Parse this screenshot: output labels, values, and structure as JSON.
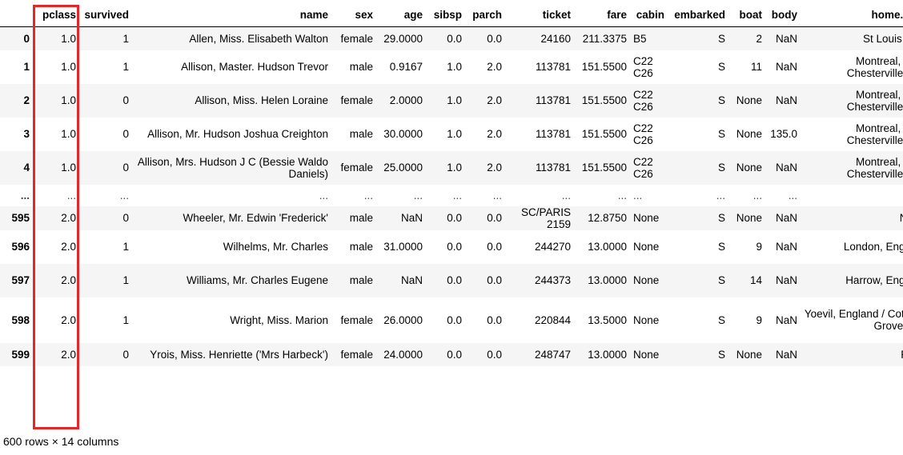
{
  "table": {
    "index_header": "",
    "columns": [
      "pclass",
      "survived",
      "name",
      "sex",
      "age",
      "sibsp",
      "parch",
      "ticket",
      "fare",
      "cabin",
      "embarked",
      "boat",
      "body",
      "home.dest"
    ],
    "rows": [
      {
        "index": "0",
        "cells": [
          "1.0",
          "1",
          "Allen, Miss. Elisabeth Walton",
          "female",
          "29.0000",
          "0.0",
          "0.0",
          "24160",
          "211.3375",
          "B5",
          "S",
          "2",
          "NaN",
          "St Louis, MO"
        ]
      },
      {
        "index": "1",
        "cells": [
          "1.0",
          "1",
          "Allison, Master. Hudson Trevor",
          "male",
          "0.9167",
          "1.0",
          "2.0",
          "113781",
          "151.5500",
          "C22 C26",
          "S",
          "11",
          "NaN",
          "Montreal, PQ / Chesterville, ON"
        ]
      },
      {
        "index": "2",
        "cells": [
          "1.0",
          "0",
          "Allison, Miss. Helen Loraine",
          "female",
          "2.0000",
          "1.0",
          "2.0",
          "113781",
          "151.5500",
          "C22 C26",
          "S",
          "None",
          "NaN",
          "Montreal, PQ / Chesterville, ON"
        ]
      },
      {
        "index": "3",
        "cells": [
          "1.0",
          "0",
          "Allison, Mr. Hudson Joshua Creighton",
          "male",
          "30.0000",
          "1.0",
          "2.0",
          "113781",
          "151.5500",
          "C22 C26",
          "S",
          "None",
          "135.0",
          "Montreal, PQ / Chesterville, ON"
        ]
      },
      {
        "index": "4",
        "cells": [
          "1.0",
          "0",
          "Allison, Mrs. Hudson J C (Bessie Waldo Daniels)",
          "female",
          "25.0000",
          "1.0",
          "2.0",
          "113781",
          "151.5500",
          "C22 C26",
          "S",
          "None",
          "NaN",
          "Montreal, PQ / Chesterville, ON"
        ]
      },
      {
        "index": "...",
        "cells": [
          "...",
          "...",
          "...",
          "...",
          "...",
          "...",
          "...",
          "...",
          "...",
          "...",
          "...",
          "...",
          "...",
          "..."
        ]
      },
      {
        "index": "595",
        "cells": [
          "2.0",
          "0",
          "Wheeler, Mr. Edwin 'Frederick'",
          "male",
          "NaN",
          "0.0",
          "0.0",
          "SC/PARIS 2159",
          "12.8750",
          "None",
          "S",
          "None",
          "NaN",
          "None"
        ]
      },
      {
        "index": "596",
        "cells": [
          "2.0",
          "1",
          "Wilhelms, Mr. Charles",
          "male",
          "31.0000",
          "0.0",
          "0.0",
          "244270",
          "13.0000",
          "None",
          "S",
          "9",
          "NaN",
          "London, England"
        ]
      },
      {
        "index": "597",
        "cells": [
          "2.0",
          "1",
          "Williams, Mr. Charles Eugene",
          "male",
          "NaN",
          "0.0",
          "0.0",
          "244373",
          "13.0000",
          "None",
          "S",
          "14",
          "NaN",
          "Harrow, England"
        ]
      },
      {
        "index": "598",
        "cells": [
          "2.0",
          "1",
          "Wright, Miss. Marion",
          "female",
          "26.0000",
          "0.0",
          "0.0",
          "220844",
          "13.5000",
          "None",
          "S",
          "9",
          "NaN",
          "Yoevil, England / Cottage Grove, OR"
        ]
      },
      {
        "index": "599",
        "cells": [
          "2.0",
          "0",
          "Yrois, Miss. Henriette ('Mrs Harbeck')",
          "female",
          "24.0000",
          "0.0",
          "0.0",
          "248747",
          "13.0000",
          "None",
          "S",
          "None",
          "NaN",
          "Paris"
        ]
      }
    ]
  },
  "footer": {
    "shape_text": "600 rows × 14 columns"
  },
  "annotation": {
    "highlight_color": "#e8262a",
    "highlighted_column": "pclass"
  }
}
